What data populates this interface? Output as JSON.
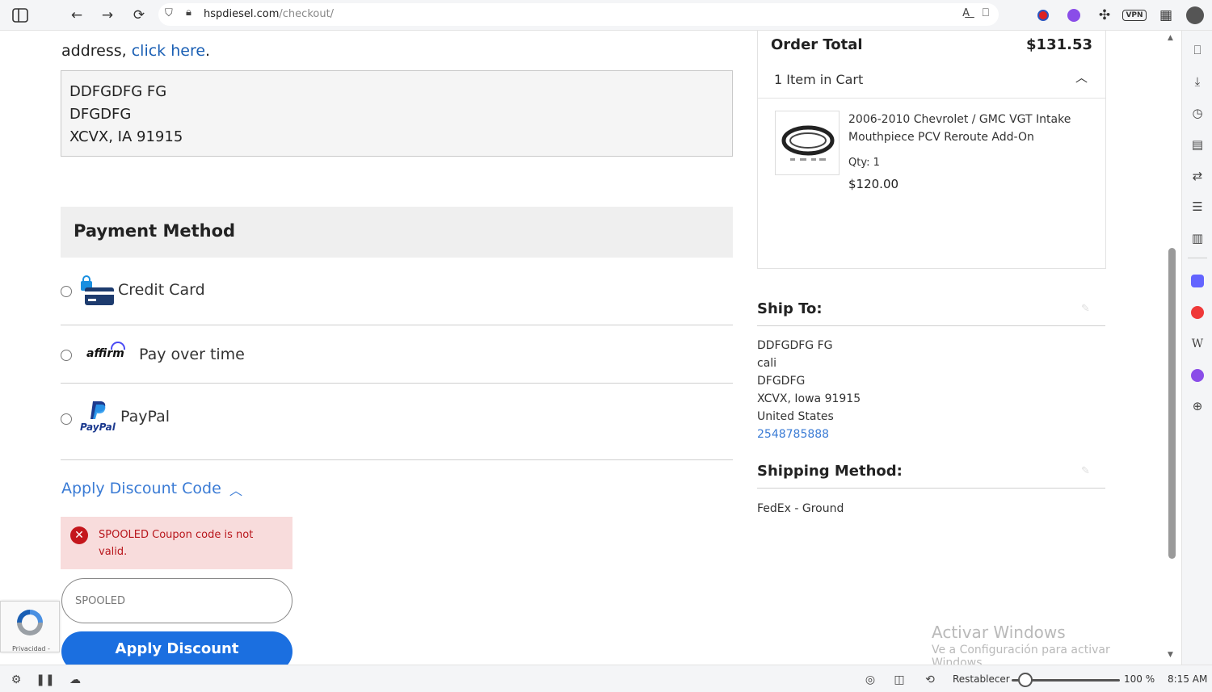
{
  "browser": {
    "url_host": "hspdiesel.com",
    "url_path": "/checkout/",
    "vpn_label": "VPN"
  },
  "address": {
    "intro_prefix": "address,",
    "intro_link": "click here",
    "intro_suffix": ".",
    "lines": [
      "DDFGDFG FG",
      "DFGDFG",
      "XCVX, IA 91915"
    ]
  },
  "payment": {
    "title": "Payment Method",
    "options": [
      {
        "label": "Credit Card",
        "icon": "credit-card-lock-icon"
      },
      {
        "label": "Pay over time",
        "brand": "affirm"
      },
      {
        "label": "PayPal",
        "brand": "PayPal"
      }
    ]
  },
  "discount": {
    "toggle_label": "Apply Discount Code",
    "error": "SPOOLED Coupon code is not valid.",
    "input_value": "SPOOLED",
    "button_label": "Apply Discount"
  },
  "recaptcha": {
    "text": "Privacidad -"
  },
  "summary": {
    "title": "Order Total",
    "total": "$131.53",
    "cart_count": "1 Item in Cart",
    "product": {
      "name": "2006-2010 Chevrolet / GMC VGT Intake Mouthpiece PCV Reroute Add-On",
      "qty": "Qty: 1",
      "price": "$120.00"
    }
  },
  "ship_to": {
    "title": "Ship To:",
    "lines": [
      "DDFGDFG FG",
      "cali",
      "DFGDFG",
      "XCVX, Iowa 91915",
      "United States"
    ],
    "phone": "2548785888"
  },
  "shipping_method": {
    "title": "Shipping Method:",
    "value": "FedEx - Ground"
  },
  "watermark": {
    "line1": "Activar Windows",
    "line2": "Ve a Configuración para activar Windows."
  },
  "statusbar": {
    "reset_label": "Restablecer",
    "zoom": "100 %",
    "time": "8:15 AM",
    "zoom_level": 0.13
  },
  "colors": {
    "accent": "#1b6fe0",
    "link": "#1a5fb4",
    "error": "#c4161c",
    "error_bg": "#f8dcdc"
  }
}
